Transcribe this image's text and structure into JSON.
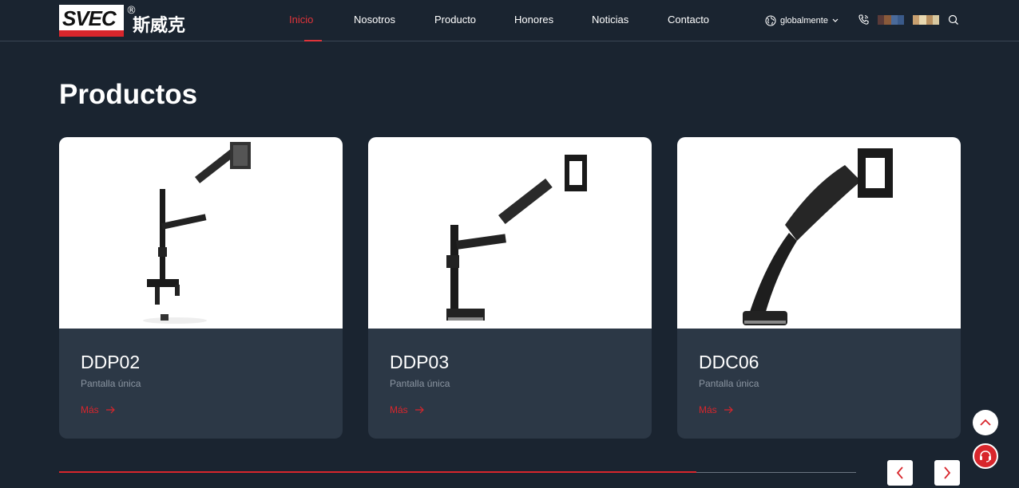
{
  "brand": {
    "logo_text": "SVEC",
    "logo_cn": "斯威克",
    "registered_mark": "®"
  },
  "nav": {
    "items": [
      {
        "label": "Inicio",
        "active": true
      },
      {
        "label": "Nosotros",
        "active": false
      },
      {
        "label": "Producto",
        "active": false
      },
      {
        "label": "Honores",
        "active": false
      },
      {
        "label": "Noticias",
        "active": false
      },
      {
        "label": "Contacto",
        "active": false
      }
    ]
  },
  "header_tools": {
    "language_label": "globalmente",
    "icons": [
      "globe-icon",
      "chevron-down-icon",
      "phone-icon",
      "flag-icon",
      "flag-icon",
      "search-icon"
    ],
    "flag_colors": [
      [
        "#5a3a38",
        "#8a5a3a",
        "#4a6a9a",
        "#3a5a8a"
      ],
      [
        "#c8a070",
        "#e8d8b0",
        "#b89060",
        "#d8c8a0"
      ]
    ]
  },
  "section": {
    "title": "Productos"
  },
  "products": [
    {
      "name": "DDP02",
      "subtitle": "Pantalla única",
      "more_label": "Más"
    },
    {
      "name": "DDP03",
      "subtitle": "Pantalla única",
      "more_label": "Más"
    },
    {
      "name": "DDC06",
      "subtitle": "Pantalla única",
      "more_label": "Más"
    }
  ],
  "carousel": {
    "progress": 0.8
  },
  "colors": {
    "accent": "#d8262c",
    "background": "#1a2430",
    "card": "#2c3846"
  }
}
